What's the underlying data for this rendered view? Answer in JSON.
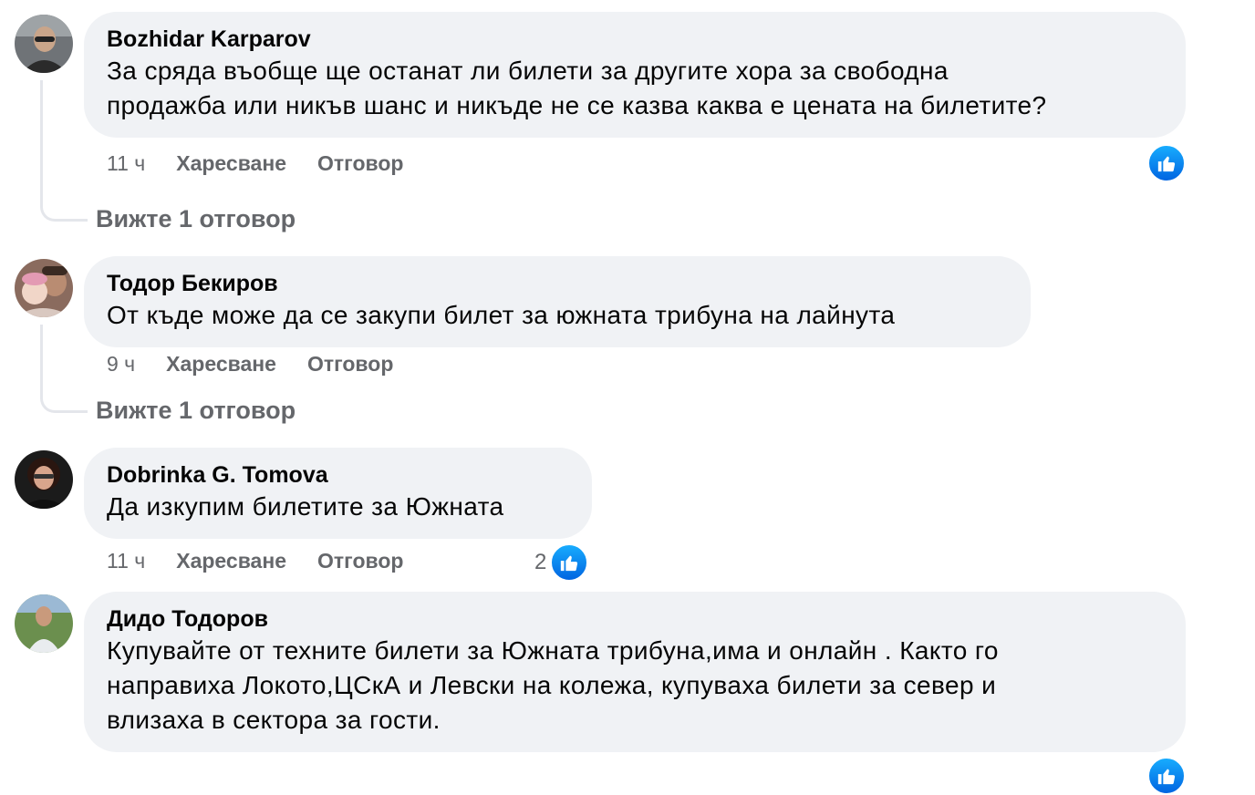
{
  "colors": {
    "bubble_bg": "#f0f2f5",
    "secondary_text": "#65676b",
    "like_blue": "#1877f2",
    "thread_line": "#e4e6eb"
  },
  "comments": [
    {
      "author": "Bozhidar Karparov",
      "text_lines": [
        "За сряда въобще ще останат ли билети за другите хора за свободна",
        "продажба или никъв шанс и никъде не се казва каква е цената на билетите?"
      ],
      "time": "11 ч",
      "like_label": "Харесване",
      "reply_label": "Отговор",
      "reaction_icon": "like-icon",
      "replies_link": "Вижте 1 отговор"
    },
    {
      "author": "Тодор Бекиров",
      "text_lines": [
        "От къде може да се закупи билет за южната трибуна на лайнута"
      ],
      "time": "9 ч",
      "like_label": "Харесване",
      "reply_label": "Отговор",
      "replies_link": "Вижте 1 отговор"
    },
    {
      "author": "Dobrinka G. Tomova",
      "text_lines": [
        "Да изкупим билетите за Южната"
      ],
      "time": "11 ч",
      "like_label": "Харесване",
      "reply_label": "Отговор",
      "reaction_count": "2",
      "reaction_icon": "like-icon"
    },
    {
      "author": "Дидо Тодоров",
      "text_lines": [
        "Купувайте от техните билети за Южната трибуна,има и онлайн . Както го",
        "направиха Локото,ЦСкА и Левски на колежа, купуваха билети за север и",
        "влизаха в сектора за гости."
      ],
      "reaction_icon": "like-icon"
    }
  ]
}
